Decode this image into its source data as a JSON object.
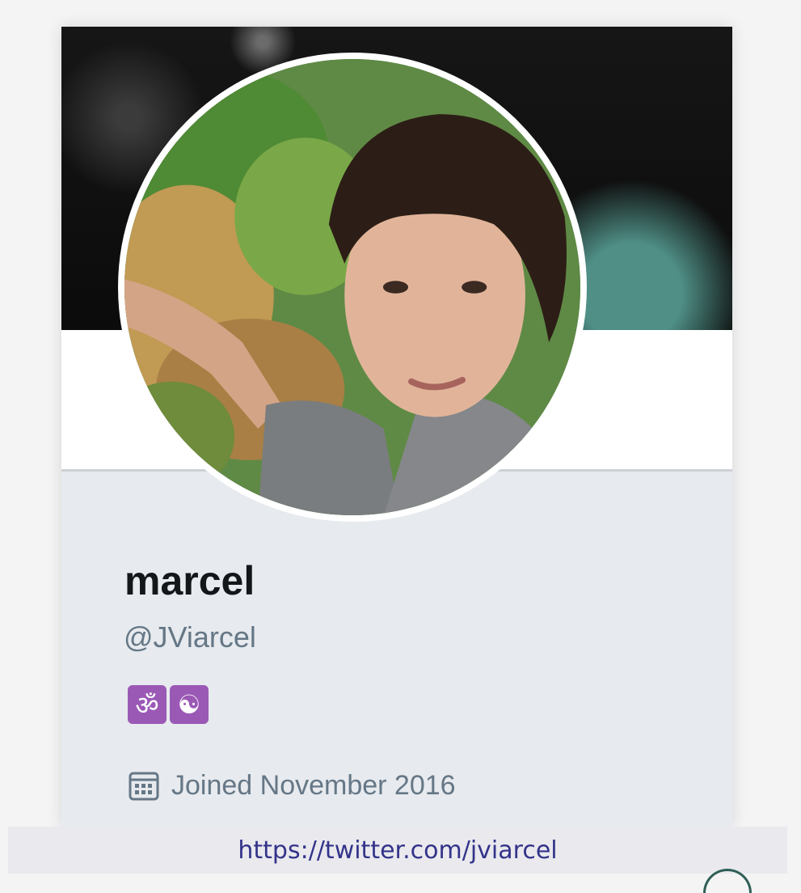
{
  "profile": {
    "display_name": "marcel",
    "handle": "@JViarcel",
    "badges": [
      {
        "glyph": "ॐ",
        "icon": "om-emoji-icon"
      },
      {
        "glyph": "☯",
        "icon": "yin-yang-emoji-icon"
      }
    ],
    "joined": "Joined November 2016"
  },
  "footer": {
    "url": "https://twitter.com/jviarcel"
  },
  "colors": {
    "banner": "#0b0b0b",
    "card_bg": "#e7eaee",
    "badge_purple": "#9b59b6",
    "muted_text": "#657786",
    "link": "#33338a"
  }
}
